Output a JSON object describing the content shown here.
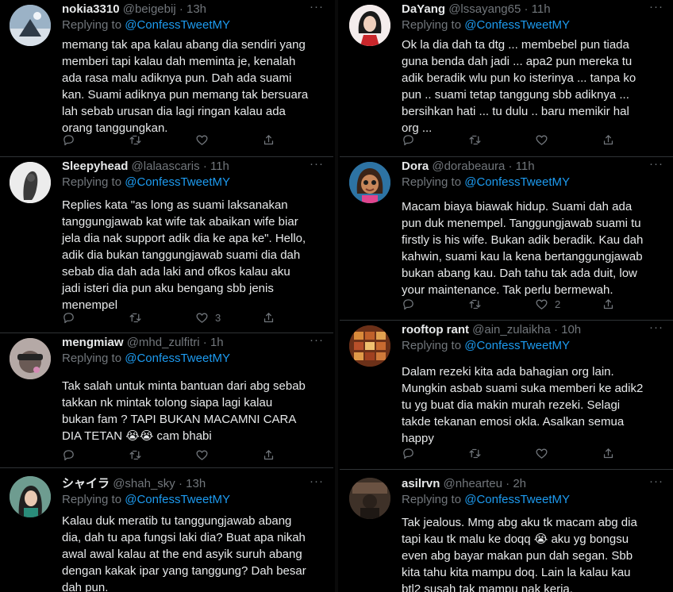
{
  "reply_prefix": "Replying to",
  "left": [
    {
      "name": "nokia3310",
      "handle": "@beigebij",
      "dot": "·",
      "time": "13h",
      "mention": "@ConfessTweetMY",
      "text": "memang tak apa kalau abang dia sendiri yang\nmemberi tapi kalau dah meminta je, kenalah\nada rasa malu adiknya pun. Dah ada suami\nkan. Suami adiknya pun memang tak bersuara\nlah sebab urusan dia lagi ringan kalau ada\norang tanggungkan.",
      "likes": ""
    },
    {
      "name": "Sleepyhead",
      "handle": "@lalaascaris",
      "dot": "·",
      "time": "11h",
      "mention": "@ConfessTweetMY",
      "text": "Replies kata \"as long as suami laksanakan\ntanggungjawab kat wife tak abaikan wife biar\njela dia nak support adik dia ke apa ke\". Hello,\nadik dia bukan tanggungjawab suami dia dah\nsebab dia dah ada laki and ofkos kalau aku\njadi isteri dia pun aku bengang sbb jenis\nmenempel",
      "likes": "3"
    },
    {
      "name": "mengmiaw",
      "handle": "@mhd_zulfitri",
      "dot": "·",
      "time": "1h",
      "mention": "@ConfessTweetMY",
      "text": "Tak salah untuk minta bantuan dari abg sebab\ntakkan nk mintak tolong siapa lagi kalau\nbukan fam ? TAPI BUKAN MACAMNI CARA\nDIA TETAN 😭😭 cam bhabi",
      "likes": ""
    },
    {
      "name": "シャイラ",
      "handle": "@shah_sky",
      "dot": "·",
      "time": "13h",
      "mention": "@ConfessTweetMY",
      "text": "Kalau duk meratib tu tanggungjawab abang\ndia, dah tu apa fungsi laki dia? Buat apa nikah\nawal awal kalau at the end asyik suruh abang\ndengan kakak ipar yang tanggung? Dah besar\ndah pun.",
      "likes": ""
    }
  ],
  "right": [
    {
      "name": "DaYang",
      "handle": "@lssayang65",
      "dot": "·",
      "time": "11h",
      "mention": "@ConfessTweetMY",
      "text": "Ok la dia dah ta dtg ... membebel pun tiada\nguna benda dah jadi ... apa2 pun mereka tu\nadik beradik wlu pun ko isterinya ... tanpa ko\npun .. suami tetap tanggung sbb adiknya ...\nbersihkan hati ... tu dulu .. baru memikir hal\norg ...",
      "likes": ""
    },
    {
      "name": "Dora",
      "handle": "@dorabeaura",
      "dot": "·",
      "time": "11h",
      "mention": "@ConfessTweetMY",
      "text": "Macam biaya biawak hidup. Suami dah ada\npun duk menempel. Tanggungjawab suami tu\nfirstly is his wife. Bukan adik beradik. Kau dah\nkahwin, suami kau la kena bertanggungjawab\nbukan abang kau. Dah tahu tak ada duit, low\nyour maintenance. Tak perlu bermewah.",
      "likes": "2"
    },
    {
      "name": "rooftop rant",
      "handle": "@ain_zulaikha",
      "dot": "·",
      "time": "10h",
      "mention": "@ConfessTweetMY",
      "text": "Dalam rezeki kita ada bahagian org lain.\nMungkin asbab suami suka memberi ke adik2\ntu yg buat dia makin murah rezeki. Selagi\ntakde tekanan emosi okla. Asalkan semua\nhappy",
      "likes": ""
    },
    {
      "name": "asilrvn",
      "handle": "@nhearteu",
      "dot": "·",
      "time": "2h",
      "mention": "@ConfessTweetMY",
      "text": "Tak jealous. Mmg abg aku tk macam abg dia\ntapi kau tk malu ke doqq 😭 aku yg bongsu\neven abg bayar makan pun dah segan. Sbb\nkita tahu kita mampu doq. Lain la kalau kau\nbtl2 susah tak mampu nak kerja.",
      "likes": ""
    }
  ],
  "icons": {
    "reply": "reply-icon",
    "retweet": "retweet-icon",
    "like": "like-icon",
    "share": "share-icon",
    "more": "more-icon"
  },
  "colors": {
    "background": "#000000",
    "text": "#e7e9ea",
    "muted": "#71767b",
    "mention": "#1d9bf0",
    "divider": "#2f3336"
  }
}
